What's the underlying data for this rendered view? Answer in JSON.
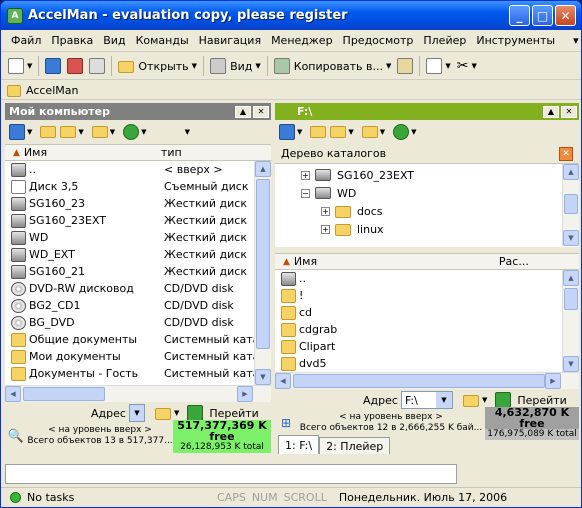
{
  "window": {
    "title": "AccelMan - evaluation copy, please register",
    "app_icon": "A",
    "min": "_",
    "max": "□",
    "close": "✕"
  },
  "menu": [
    "Файл",
    "Правка",
    "Вид",
    "Команды",
    "Навигация",
    "Менеджер",
    "Предосмотр",
    "Плейер",
    "Инструменты"
  ],
  "toolbar": {
    "open": "Открыть",
    "view": "Вид",
    "copy": "Копировать в..."
  },
  "crumb": "AccelMan",
  "left": {
    "title": "Мой компьютер",
    "col_name": "Имя",
    "col_type": "тип",
    "rows": [
      {
        "name": "..",
        "type": "< вверх >",
        "icon": "up"
      },
      {
        "name": "Диск 3,5",
        "type": "Съемный диск",
        "icon": "floppy"
      },
      {
        "name": "SG160_23",
        "type": "Жесткий диск",
        "icon": "drive"
      },
      {
        "name": "SG160_23EXT",
        "type": "Жесткий диск",
        "icon": "drive"
      },
      {
        "name": "WD",
        "type": "Жесткий диск",
        "icon": "drive"
      },
      {
        "name": "WD_EXT",
        "type": "Жесткий диск",
        "icon": "drive"
      },
      {
        "name": "SG160_21",
        "type": "Жесткий диск",
        "icon": "drive"
      },
      {
        "name": "DVD-RW дисковод",
        "type": "CD/DVD disk",
        "icon": "cd"
      },
      {
        "name": "BG2_CD1",
        "type": "CD/DVD disk",
        "icon": "cd"
      },
      {
        "name": "BG_DVD",
        "type": "CD/DVD disk",
        "icon": "cd"
      },
      {
        "name": "Общие документы",
        "type": "Системный катал",
        "icon": "folder"
      },
      {
        "name": "Мои документы",
        "type": "Системный катал",
        "icon": "folder"
      },
      {
        "name": "Документы - Гость",
        "type": "Системный катал",
        "icon": "folder"
      }
    ],
    "addr_label": "Адрес",
    "go": "Перейти",
    "status_up": "< на уровень вверх >",
    "status_total": "Всего объектов 13 в 517,377...",
    "free_big": "517,377,369 K free",
    "free_small": "26,128,953 K total"
  },
  "right": {
    "title": "F:\\",
    "tree_title": "Дерево каталогов",
    "tree": [
      {
        "label": "SG160_23EXT",
        "sign": "+",
        "indent": 26,
        "icon": "drive"
      },
      {
        "label": "WD",
        "sign": "−",
        "indent": 26,
        "icon": "drive"
      },
      {
        "label": "docs",
        "sign": "+",
        "indent": 46,
        "icon": "folder"
      },
      {
        "label": "linux",
        "sign": "+",
        "indent": 46,
        "icon": "folder"
      }
    ],
    "col_name": "Имя",
    "col_ext": "Рас...",
    "rows": [
      {
        "name": "..",
        "icon": "drive"
      },
      {
        "name": "!",
        "icon": "folder"
      },
      {
        "name": "cd",
        "icon": "folder"
      },
      {
        "name": "cdgrab",
        "icon": "folder"
      },
      {
        "name": "Clipart",
        "icon": "folder"
      },
      {
        "name": "dvd5",
        "icon": "folder"
      }
    ],
    "addr_label": "Адрес",
    "addr_value": "F:\\",
    "go": "Перейти",
    "status_up": "< на уровень вверх >",
    "status_total": "Всего объектов 12 в 2,666,255 K бай...",
    "free_big": "4,632,870 K free",
    "free_small": "176,975,089 K total",
    "tabs": [
      "1: F:\\",
      "2: Плейер"
    ]
  },
  "status": {
    "text": "No tasks",
    "caps": "CAPS",
    "num": "NUM",
    "scroll": "SCROLL",
    "date": "Понедельник. Июль 17, 2006"
  }
}
